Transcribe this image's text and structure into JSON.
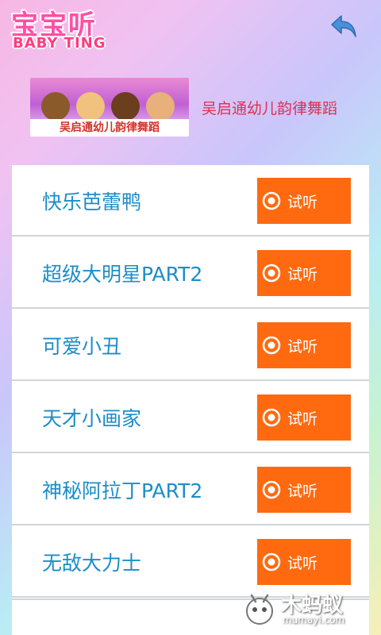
{
  "app": {
    "logo_cn": "宝宝听",
    "logo_en": "BABY TING"
  },
  "album": {
    "thumb_caption": "吴启通幼儿韵律舞蹈",
    "title": "吴启通幼儿韵律舞蹈"
  },
  "songs": [
    {
      "title": "快乐芭蕾鸭",
      "button": "试听"
    },
    {
      "title": "超级大明星PART2",
      "button": "试听"
    },
    {
      "title": "可爱小丑",
      "button": "试听"
    },
    {
      "title": "天才小画家",
      "button": "试听"
    },
    {
      "title": "神秘阿拉丁PART2",
      "button": "试听"
    },
    {
      "title": "无敌大力士",
      "button": "试听"
    }
  ],
  "watermark": {
    "text": "木蚂蚁",
    "url": "mumayi.com"
  },
  "colors": {
    "accent": "#ff6a10",
    "song_title": "#1b8ec8",
    "album_title": "#e03050",
    "logo": "#ff4fa6"
  },
  "icons": {
    "back": "back-arrow-icon",
    "listen": "speaker-icon"
  }
}
